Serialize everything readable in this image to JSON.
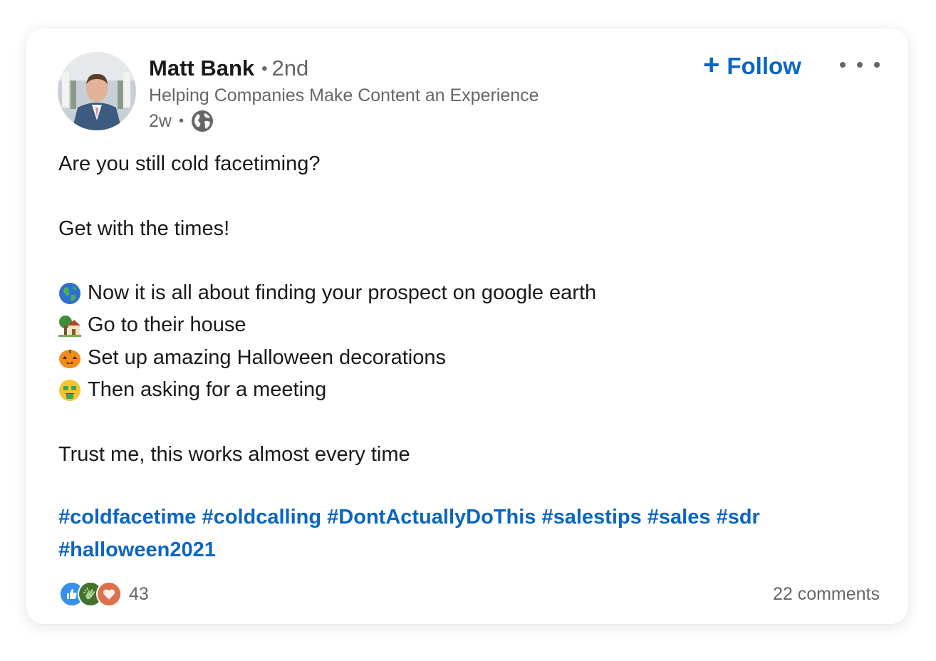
{
  "author": {
    "name": "Matt Bank",
    "separator": "•",
    "degree": "2nd",
    "headline": "Helping Companies Make Content an Experience",
    "time": "2w",
    "visibility_icon": "globe-icon"
  },
  "follow": {
    "plus": "+",
    "label": "Follow"
  },
  "more_icon": "more-horizontal-icon",
  "post": {
    "line1": "Are you still cold facetiming?",
    "line2": "Get with the times!",
    "bullets": [
      {
        "emoji": "globe-earth-icon",
        "text": "Now it is all about finding your prospect on google earth"
      },
      {
        "emoji": "house-garden-icon",
        "text": "Go to their house"
      },
      {
        "emoji": "jack-o-lantern-icon",
        "text": "Set up amazing Halloween decorations"
      },
      {
        "emoji": "money-mouth-face-icon",
        "text": "Then asking for a meeting"
      }
    ],
    "closing": "Trust me, this works almost every time"
  },
  "hashtags": [
    "#coldfacetime",
    "#coldcalling",
    "#DontActuallyDoThis",
    "#salestips",
    "#sales",
    "#sdr",
    "#halloween2021"
  ],
  "reactions": {
    "icons": [
      "like-icon",
      "celebrate-icon",
      "love-icon"
    ],
    "count": "43"
  },
  "comments": "22 comments",
  "colors": {
    "link": "#0a66c2",
    "text": "#191919",
    "muted": "#666666"
  }
}
